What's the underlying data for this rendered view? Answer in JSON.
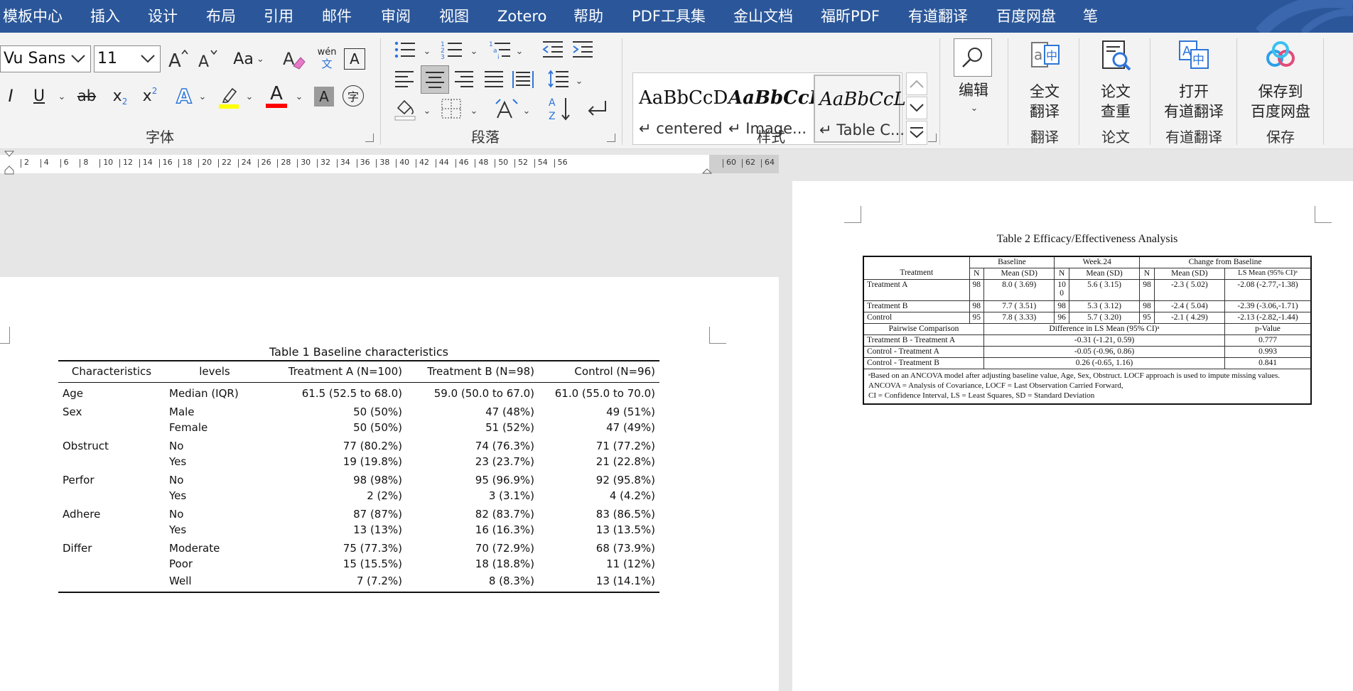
{
  "menubar": {
    "items": [
      "模板中心",
      "插入",
      "设计",
      "布局",
      "引用",
      "邮件",
      "审阅",
      "视图",
      "Zotero",
      "帮助",
      "PDF工具集",
      "金山文档",
      "福昕PDF",
      "有道翻译",
      "百度网盘",
      "笔"
    ]
  },
  "ribbon": {
    "font": {
      "group_label": "字体",
      "font_name": "Vu Sans",
      "font_size": "11",
      "change_case": "Aa",
      "phonetic_top": "wén",
      "phonetic_bottom": "文",
      "char_border": "A",
      "italic": "I",
      "underline": "U",
      "strike": "ab",
      "subscript": "x",
      "subscript_mark": "2",
      "superscript": "x",
      "superscript_mark": "2",
      "text_effect": "A",
      "font_color": "A",
      "char_shading": "A",
      "enclose_char": "字",
      "highlight_color": "#ffff00",
      "font_color_value": "#ff0000"
    },
    "paragraph": {
      "group_label": "段落"
    },
    "styles": {
      "group_label": "样式",
      "tiles": [
        {
          "preview": "AaBbCcD",
          "name": "↵ centered"
        },
        {
          "preview": "AaBbCcL",
          "name": "↵ Image..."
        },
        {
          "preview": "AaBbCcL",
          "name": "↵ Table C..."
        }
      ]
    },
    "edit": {
      "label": "编辑"
    },
    "translate": {
      "button": [
        "全文",
        "翻译"
      ],
      "group_label": "翻译"
    },
    "paper": {
      "button": [
        "论文",
        "查重"
      ],
      "group_label": "论文"
    },
    "youdao": {
      "button": [
        "打开",
        "有道翻译"
      ],
      "group_label": "有道翻译"
    },
    "save": {
      "button": [
        "保存到",
        "百度网盘"
      ],
      "group_label": "保存"
    }
  },
  "ruler": {
    "ticks": [
      "2",
      "4",
      "6",
      "8",
      "10",
      "12",
      "14",
      "16",
      "18",
      "20",
      "22",
      "24",
      "26",
      "28",
      "30",
      "32",
      "34",
      "36",
      "38",
      "40",
      "42",
      "44",
      "46",
      "48",
      "50",
      "52",
      "54",
      "56",
      "60",
      "62",
      "64"
    ]
  },
  "table1": {
    "caption": "Table 1  Baseline characteristics",
    "headers": [
      "Characteristics",
      "levels",
      "Treatment A (N=100)",
      "Treatment B (N=98)",
      "Control (N=96)"
    ],
    "rows": [
      [
        "Age",
        "Median (IQR)",
        "61.5 (52.5 to 68.0)",
        "59.0 (50.0 to 67.0)",
        "61.0 (55.0 to 70.0)"
      ],
      [
        "Sex",
        "Male",
        "50 (50%)",
        "47 (48%)",
        "49 (51%)"
      ],
      [
        "",
        "Female",
        "50 (50%)",
        "51 (52%)",
        "47 (49%)"
      ],
      [
        "Obstruct",
        "No",
        "77 (80.2%)",
        "74 (76.3%)",
        "71 (77.2%)"
      ],
      [
        "",
        "Yes",
        "19 (19.8%)",
        "23 (23.7%)",
        "21 (22.8%)"
      ],
      [
        "Perfor",
        "No",
        "98 (98%)",
        "95 (96.9%)",
        "92 (95.8%)"
      ],
      [
        "",
        "Yes",
        "2 (2%)",
        "3 (3.1%)",
        "4 (4.2%)"
      ],
      [
        "Adhere",
        "No",
        "87 (87%)",
        "82 (83.7%)",
        "83 (86.5%)"
      ],
      [
        "",
        "Yes",
        "13 (13%)",
        "16 (16.3%)",
        "13 (13.5%)"
      ],
      [
        "Differ",
        "Moderate",
        "75 (77.3%)",
        "70 (72.9%)",
        "68 (73.9%)"
      ],
      [
        "",
        "Poor",
        "15 (15.5%)",
        "18 (18.8%)",
        "11 (12%)"
      ],
      [
        "",
        "Well",
        "7 (7.2%)",
        "8 (8.3%)",
        "13 (14.1%)"
      ]
    ]
  },
  "table2": {
    "caption": "Table 2  Efficacy/Effectiveness Analysis",
    "group_headers": [
      "Baseline",
      "Week.24",
      "Change from Baseline"
    ],
    "headers": [
      "Treatment",
      "N",
      "Mean (SD)",
      "N",
      "Mean (SD)",
      "N",
      "Mean (SD)",
      "LS Mean (95% CI)ᵃ"
    ],
    "rows": [
      [
        "Treatment A",
        "98",
        "8.0 ( 3.69)",
        "10\n0",
        "5.6 ( 3.15)",
        "98",
        "-2.3 ( 5.02)",
        "-2.08 (-2.77,-1.38)"
      ],
      [
        "Treatment B",
        "98",
        "7.7 ( 3.51)",
        "98",
        "5.3 ( 3.12)",
        "98",
        "-2.4 ( 5.04)",
        "-2.39 (-3.06,-1.71)"
      ],
      [
        "Control",
        "95",
        "7.8 ( 3.33)",
        "96",
        "5.7 ( 3.20)",
        "95",
        "-2.1 ( 4.29)",
        "-2.13 (-2.82,-1.44)"
      ]
    ],
    "pairwise_headers": [
      "Pairwise Comparison",
      "Difference in LS Mean (95% CI)ᵃ",
      "p-Value"
    ],
    "pairwise": [
      [
        "Treatment B - Treatment A",
        "-0.31 (-1.21, 0.59)",
        "0.777"
      ],
      [
        "Control - Treatment A",
        "-0.05 (-0.96, 0.86)",
        "0.993"
      ],
      [
        "Control - Treatment B",
        "0.26 (-0.65, 1.16)",
        "0.841"
      ]
    ],
    "notes": [
      "ᵃBased on an ANCOVA model after adjusting baseline value, Age, Sex, Obstruct. LOCF approach is used to impute missing values.",
      "ANCOVA = Analysis of Covariance, LOCF = Last Observation Carried Forward,",
      "CI = Confidence Interval, LS = Least Squares, SD = Standard Deviation"
    ]
  },
  "colors": {
    "menubar_bg": "#2b579a",
    "ribbon_bg": "#f3f3f3",
    "workspace_bg": "#e6e6e6",
    "accent_blue": "#2e75d8"
  }
}
